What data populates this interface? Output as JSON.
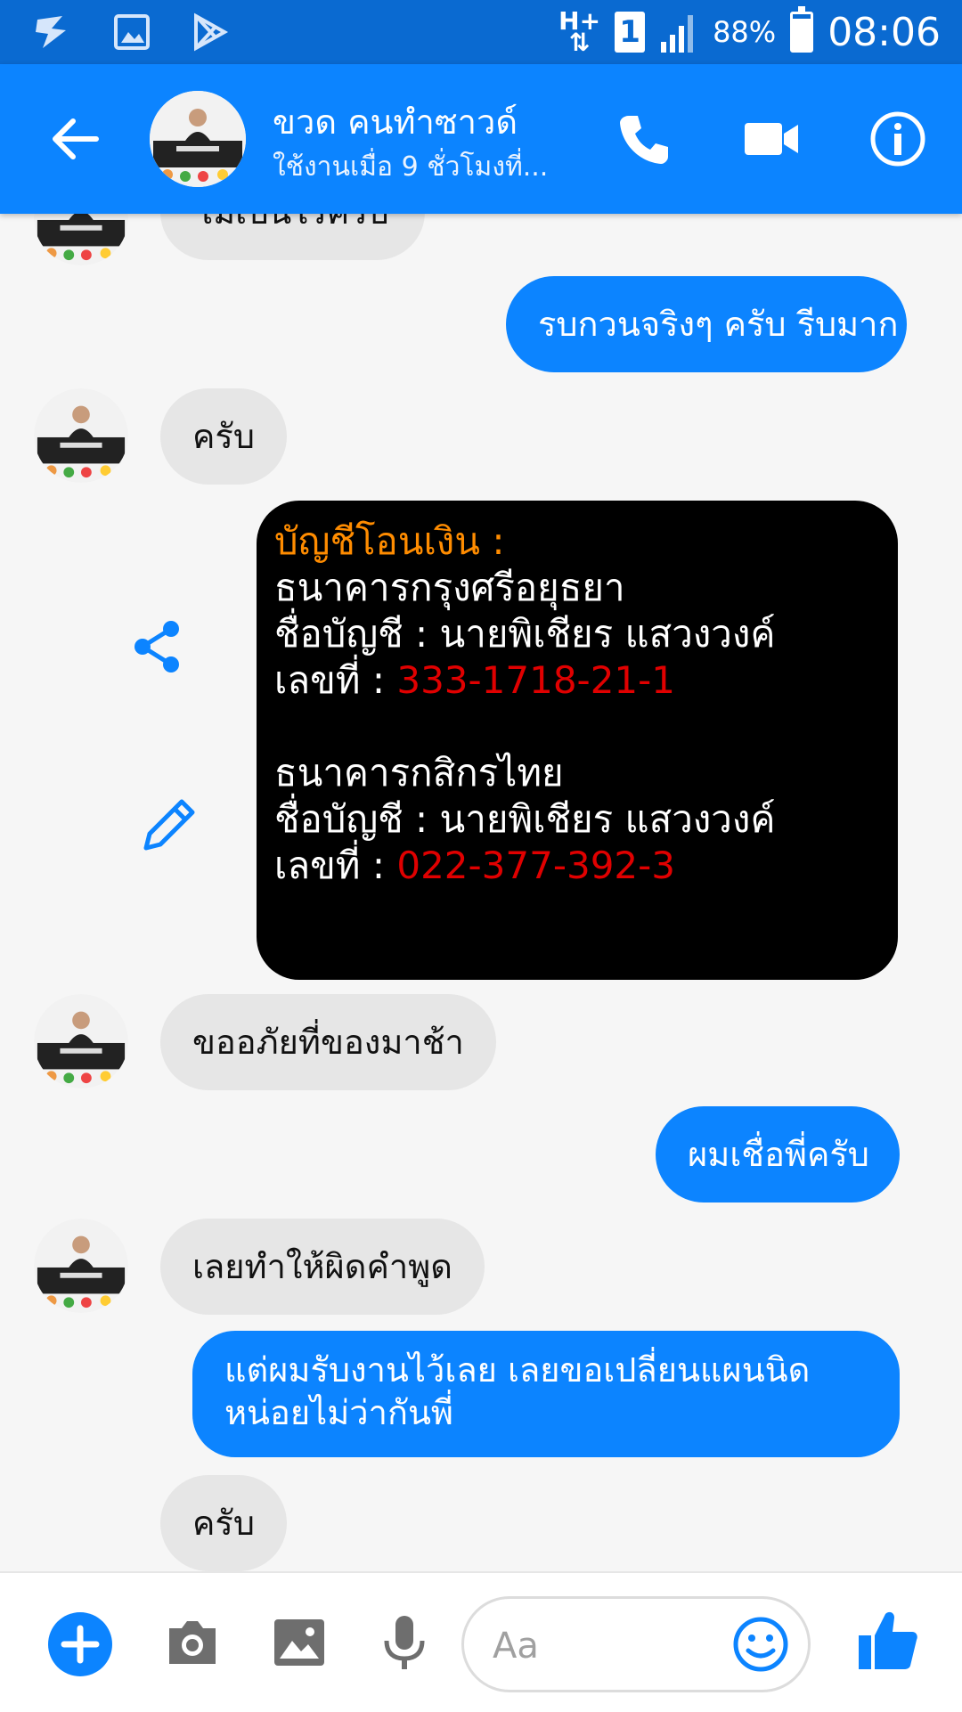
{
  "status_bar": {
    "network_type": "H+",
    "sim_slot": "1",
    "battery_text": "88%",
    "time": "08:06"
  },
  "header": {
    "contact_name": "ขวด คนทำซาวด์",
    "status": "ใช้งานเมื่อ 9 ชั่วโมงที่..."
  },
  "messages": [
    {
      "side": "in",
      "text": "ไม่เป็นไรครับ"
    },
    {
      "side": "out",
      "text": "รบกวนจริงๆ ครับ รีบมาก"
    },
    {
      "side": "in",
      "text": "ครับ"
    },
    {
      "side": "in",
      "text": "ขออภัยที่ของมาช้า"
    },
    {
      "side": "out",
      "text": "ผมเชื่อพี่ครับ"
    },
    {
      "side": "in",
      "text": "เลยทำให้ผิดคำพูด"
    },
    {
      "side": "out",
      "line1": "แต่ผมรับงานไว้เลย เลยขอเปลี่ยนแผนนิด",
      "line2": "หน่อยไม่ว่ากันพี่"
    },
    {
      "side": "in",
      "text": "ครับ"
    }
  ],
  "bank_image": {
    "heading": "บัญชีโอนเงิน :",
    "bank1": {
      "name": "ธนาคารกรุงศรีอยุธยา",
      "account_label": "ชื่อบัญชี : นายพิเชียร แสวงวงค์",
      "number_label": "เลขที่ : ",
      "number": "333-1718-21-1"
    },
    "bank2": {
      "name": "ธนาคารกสิกรไทย",
      "account_label": "ชื่อบัญชี : นายพิเชียร แสวงวงค์",
      "number_label": "เลขที่ : ",
      "number": "022-377-392-3"
    }
  },
  "composer": {
    "placeholder": "Aa"
  },
  "colors": {
    "status_bar": "#0a6ad1",
    "header": "#0c84ff",
    "outgoing_bubble": "#0c84ff",
    "incoming_bubble": "#e6e6e6",
    "account_number": "#e00000",
    "bank_heading": "#ff8c00"
  }
}
